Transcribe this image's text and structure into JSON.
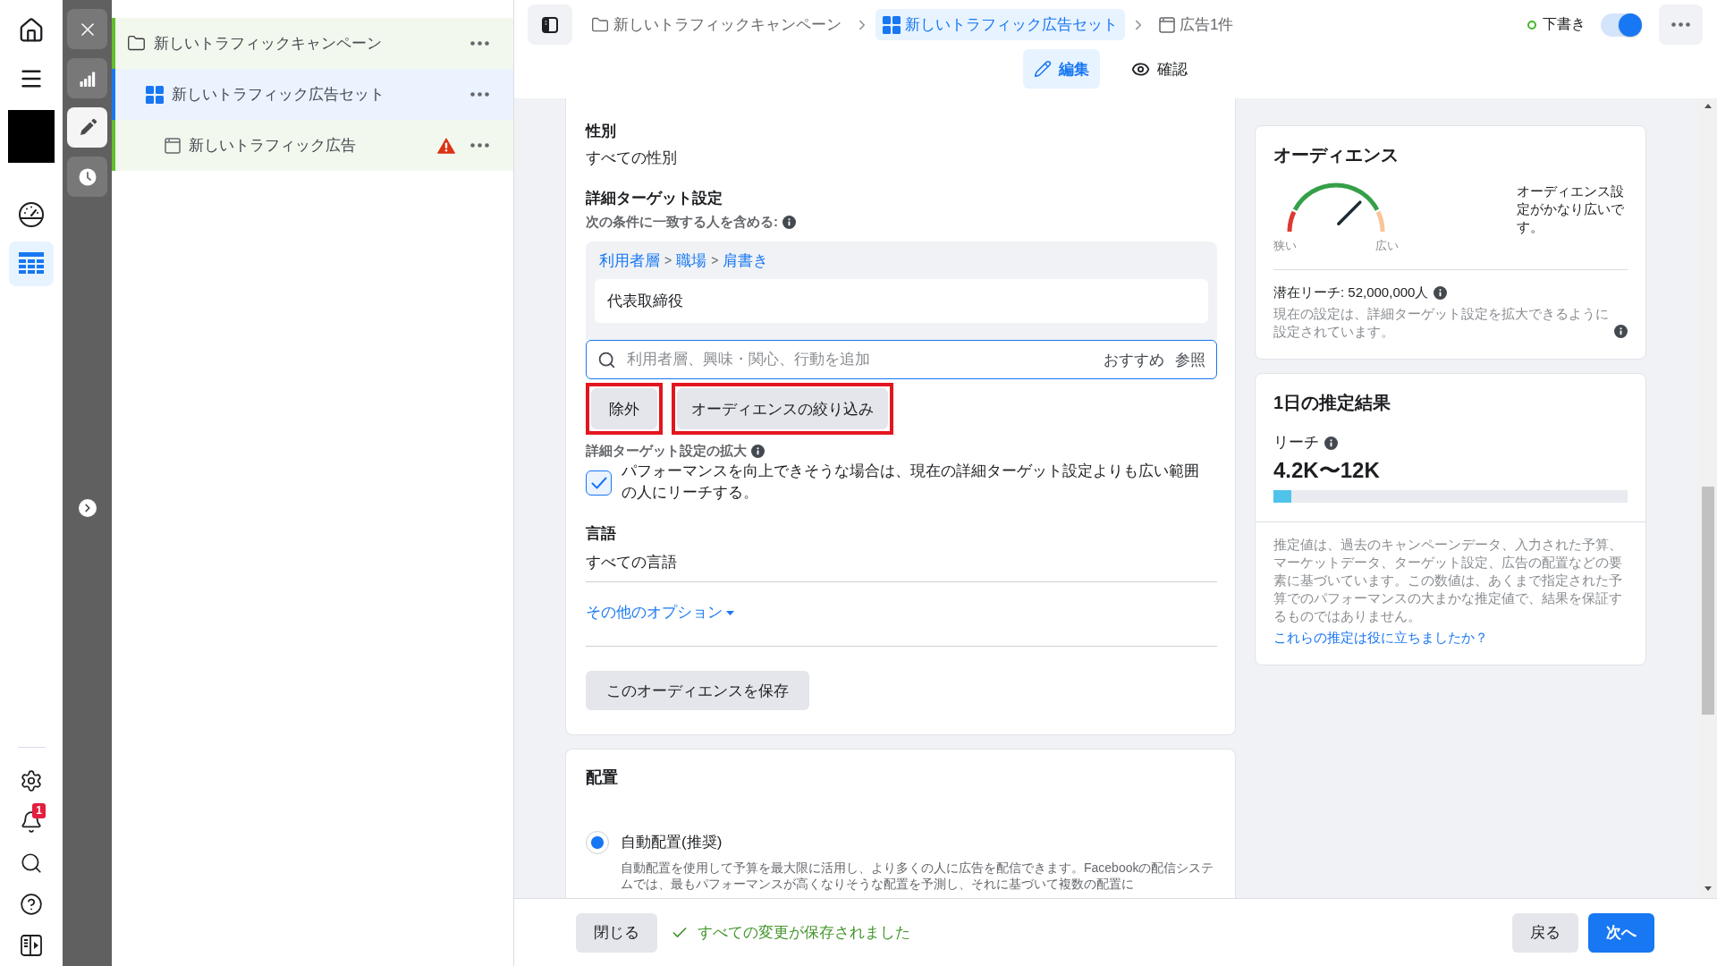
{
  "left_nav": {
    "items": [
      {
        "selected": false
      },
      {
        "selected": false
      },
      {
        "selected": false
      },
      {
        "selected": true
      }
    ],
    "notification_badge": "1"
  },
  "tool_strip": {
    "tabs": [
      {
        "selected": false
      },
      {
        "selected": true
      },
      {
        "selected": false
      }
    ]
  },
  "tree": [
    {
      "label": "新しいトラフィックキャンペーン",
      "selected": false,
      "warning": false,
      "children": [
        {
          "label": "新しいトラフィック広告セット",
          "selected": true,
          "warning": false,
          "children": [
            {
              "label": "新しいトラフィック広告",
              "selected": false,
              "warning": true
            }
          ]
        }
      ]
    }
  ],
  "breadcrumbs": [
    {
      "label": "新しいトラフィックキャンペーン",
      "selected": false
    },
    {
      "label": "新しいトラフィック広告セット",
      "selected": true
    },
    {
      "label": "広告1件",
      "selected": false
    }
  ],
  "status": {
    "label": "下書き",
    "on": true
  },
  "view_tabs": [
    {
      "label": "編集",
      "selected": true
    },
    {
      "label": "確認",
      "selected": false
    }
  ],
  "audience_form": {
    "gender": {
      "label": "性別",
      "value": "すべての性別"
    },
    "detailed_targeting": {
      "label": "詳細ターゲット設定",
      "include_label": "次の条件に一致する人を含める:",
      "path": [
        {
          "kind": "link",
          "text": "利用者層"
        },
        {
          "kind": "separator",
          "text": ">"
        },
        {
          "kind": "link",
          "text": "職場"
        },
        {
          "kind": "separator",
          "text": ">"
        },
        {
          "kind": "link",
          "text": "肩書き"
        }
      ],
      "selected_item": "代表取締役",
      "search": {
        "placeholder": "利用者層、興味・関心、行動を追加",
        "actions": [
          "おすすめ",
          "参照"
        ]
      },
      "buttons": [
        {
          "label": "除外",
          "highlighted": true
        },
        {
          "label": "オーディエンスの絞り込み",
          "highlighted": true
        }
      ]
    },
    "expansion": {
      "label": "詳細ターゲット設定の拡大",
      "checked": true,
      "text": "パフォーマンスを向上できそうな場合は、現在の詳細ターゲット設定よりも広い範囲の人にリーチする。"
    },
    "language": {
      "label": "言語",
      "value": "すべての言語"
    },
    "more_options": "その他のオプション",
    "save_button": "このオーディエンスを保存"
  },
  "placement": {
    "title": "配置",
    "options": [
      {
        "label": "自動配置(推奨)",
        "selected": true,
        "description": "自動配置を使用して予算を最大限に活用し、より多くの人に広告を配信できます。Facebookの配信システムでは、最もパフォーマンスが高くなりそうな配置を予測し、それに基づいて複数の配置に"
      }
    ]
  },
  "audience_card": {
    "title": "オーディエンス",
    "gauge": {
      "level": 0.75,
      "min_label": "狭い",
      "max_label": "広い"
    },
    "verdict": "オーディエンス設定がかなり広いです。",
    "potential_reach": "潜在リーチ: 52,000,000人",
    "note": "現在の設定は、詳細ターゲット設定を拡大できるように設定されています。"
  },
  "estimate_card": {
    "title": "1日の推定結果",
    "reach": {
      "label": "リーチ",
      "value": "4.2K〜12K",
      "level": 0.05
    },
    "disclaimer": "推定値は、過去のキャンペーンデータ、入力された予算、マーケットデータ、ターゲット設定、広告の配置などの要素に基づいています。この数値は、あくまで指定された予算でのパフォーマンスの大まかな推定値で、結果を保証するものではありません。",
    "feedback_link": "これらの推定は役に立ちましたか？"
  },
  "footer": {
    "close_button": "閉じる",
    "saved_status": "すべての変更が保存されました",
    "back_button": "戻る",
    "next_button": "次へ"
  }
}
